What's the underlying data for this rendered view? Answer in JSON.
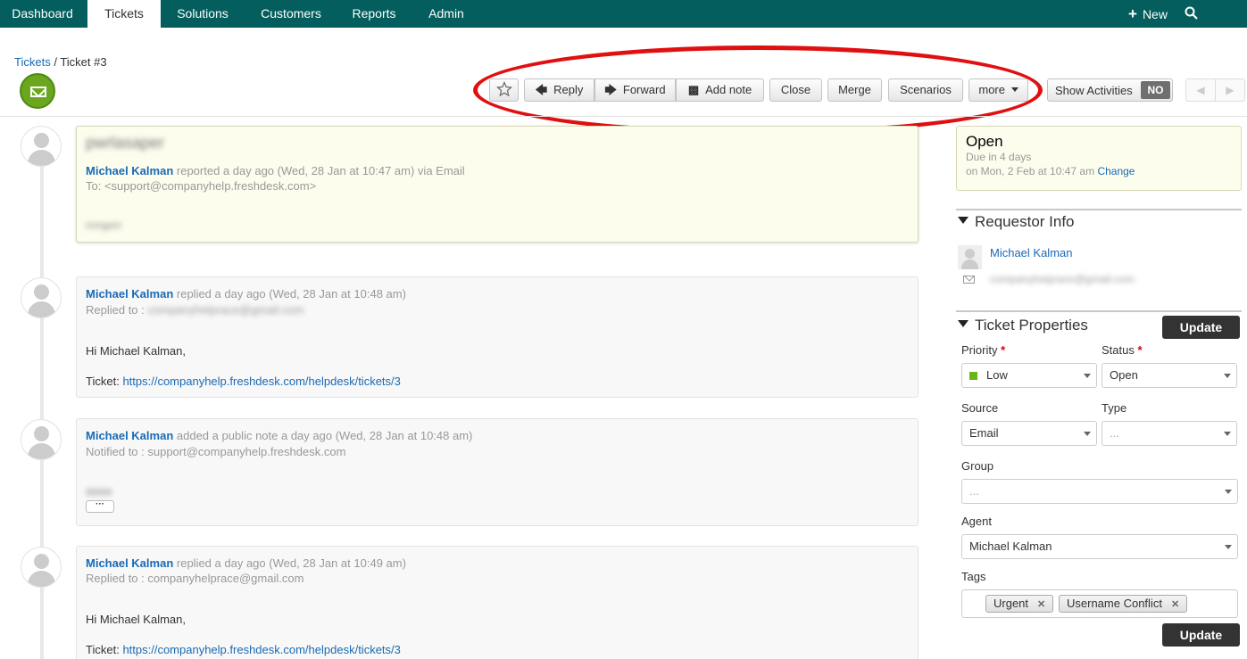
{
  "nav": {
    "tabs": [
      "Dashboard",
      "Tickets",
      "Solutions",
      "Customers",
      "Reports",
      "Admin"
    ],
    "new_label": "New",
    "search_label": "Search"
  },
  "breadcrumb": {
    "root": "Tickets",
    "current": "Ticket #3"
  },
  "toolbar": {
    "reply": "Reply",
    "forward": "Forward",
    "add_note": "Add note",
    "close": "Close",
    "merge": "Merge",
    "scenarios": "Scenarios",
    "more": "more",
    "show_activities": "Show Activities",
    "toggle_value": "NO"
  },
  "conversation": [
    {
      "subject": "pwrlasaper",
      "author": "Michael Kalman",
      "action": "reported a day ago (Wed, 28 Jan at 10:47 am) via Email",
      "line2": "To: <support@companyhelp.freshdesk.com>",
      "body_blur": "rrrnprrr"
    },
    {
      "author": "Michael Kalman",
      "action": "replied a day ago (Wed, 28 Jan at 10:48 am)",
      "line2": "Replied to :",
      "line2_blur": "companyhelprace@gmail.com",
      "greeting": "Hi Michael Kalman,",
      "ticket_label": "Ticket:",
      "ticket_link": "https://companyhelp.freshdesk.com/helpdesk/tickets/3"
    },
    {
      "author": "Michael Kalman",
      "action": "added a public note a day ago (Wed, 28 Jan at 10:48 am)",
      "line2": "Notified to : support@companyhelp.freshdesk.com",
      "body_blur": "aaaa"
    },
    {
      "author": "Michael Kalman",
      "action": "replied a day ago (Wed, 28 Jan at 10:49 am)",
      "line2": "Replied to : companyhelprace@gmail.com",
      "greeting": "Hi Michael Kalman,",
      "ticket_label": "Ticket:",
      "ticket_link": "https://companyhelp.freshdesk.com/helpdesk/tickets/3"
    }
  ],
  "status": {
    "state": "Open",
    "due": "Due in 4 days",
    "on": "on Mon, 2 Feb at 10:47 am",
    "change": "Change"
  },
  "requestor": {
    "title": "Requestor Info",
    "name": "Michael Kalman",
    "email_blur": "companyhelprace@gmail.com"
  },
  "properties": {
    "title": "Ticket Properties",
    "update": "Update",
    "priority_label": "Priority",
    "priority_value": "Low",
    "status_label": "Status",
    "status_value": "Open",
    "source_label": "Source",
    "source_value": "Email",
    "type_label": "Type",
    "type_placeholder": "...",
    "group_label": "Group",
    "group_placeholder": "...",
    "agent_label": "Agent",
    "agent_value": "Michael Kalman",
    "tags_label": "Tags",
    "tags": [
      "Urgent",
      "Username Conflict"
    ],
    "required_mark": "*"
  },
  "colors": {
    "nav_bg": "#045e5e",
    "link": "#1a6ab5",
    "highlight": "#e01010",
    "priority_low": "#6ab519"
  },
  "icons": [
    "plus-icon",
    "search-icon",
    "envelope-icon",
    "star-icon",
    "reply-arrow-icon",
    "forward-arrow-icon",
    "add-note-icon",
    "caret-down-icon",
    "prev-icon",
    "next-icon",
    "mail-icon",
    "remove-tag-icon"
  ]
}
